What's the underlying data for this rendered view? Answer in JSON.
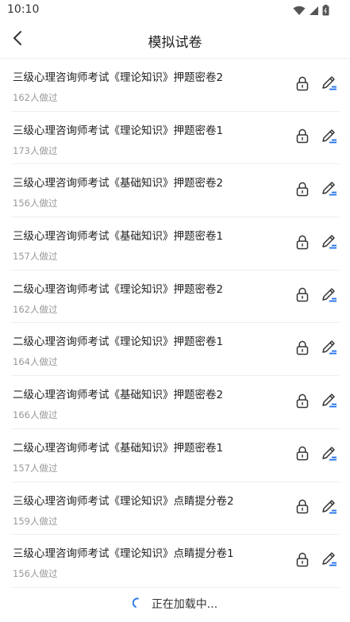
{
  "status_bar": {
    "time": "10:10",
    "icons": [
      "wifi-icon",
      "signal-icon",
      "battery-icon"
    ]
  },
  "nav": {
    "title": "模拟试卷",
    "back_icon": "chevron-left-icon"
  },
  "colors": {
    "accent": "#1e6fe8",
    "icon": "#333333",
    "meta": "#999999"
  },
  "items": [
    {
      "title": "三级心理咨询师考试《理论知识》押题密卷2",
      "meta": "162人做过"
    },
    {
      "title": "三级心理咨询师考试《理论知识》押题密卷1",
      "meta": "173人做过"
    },
    {
      "title": "三级心理咨询师考试《基础知识》押题密卷2",
      "meta": "156人做过"
    },
    {
      "title": "三级心理咨询师考试《基础知识》押题密卷1",
      "meta": "157人做过"
    },
    {
      "title": "二级心理咨询师考试《理论知识》押题密卷2",
      "meta": "162人做过"
    },
    {
      "title": "二级心理咨询师考试《理论知识》押题密卷1",
      "meta": "164人做过"
    },
    {
      "title": "二级心理咨询师考试《基础知识》押题密卷2",
      "meta": "166人做过"
    },
    {
      "title": "二级心理咨询师考试《基础知识》押题密卷1",
      "meta": "157人做过"
    },
    {
      "title": "三级心理咨询师考试《理论知识》点睛提分卷2",
      "meta": "159人做过"
    },
    {
      "title": "三级心理咨询师考试《理论知识》点睛提分卷1",
      "meta": "156人做过"
    }
  ],
  "loading": {
    "text": "正在加载中..."
  }
}
